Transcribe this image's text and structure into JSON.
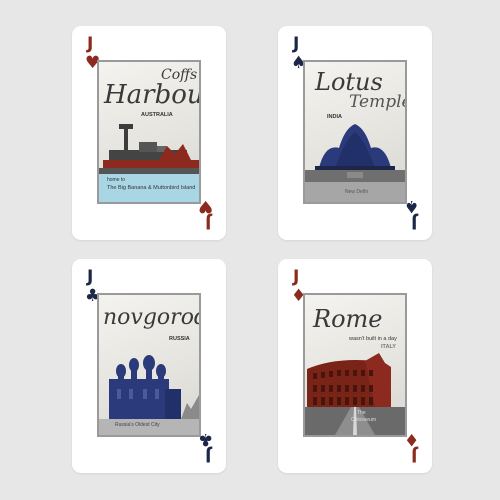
{
  "colors": {
    "background": "#e7e7e7",
    "card": "#ffffff",
    "red_suit": "#8c2a1f",
    "navy_suit": "#1c2748"
  },
  "cards": [
    {
      "rank": "J",
      "suit": "♥",
      "suit_name": "hearts",
      "title_line1": "Coffs",
      "title_line2": "Harbour",
      "country": "AUSTRALIA",
      "caption_line1": "home to",
      "caption_line2": "The Big Banana & Muttonbird Island"
    },
    {
      "rank": "J",
      "suit": "♠",
      "suit_name": "spades",
      "title_line1": "Lotus",
      "title_line2": "Temple",
      "country": "INDIA",
      "caption_line1": "New Delhi"
    },
    {
      "rank": "J",
      "suit": "♣",
      "suit_name": "clubs",
      "title_line1": "novgorod",
      "country": "RUSSIA",
      "caption_line1": "Russia's Oldest City"
    },
    {
      "rank": "J",
      "suit": "♦",
      "suit_name": "diamonds",
      "title_line1": "Rome",
      "subtitle": "wasn't built in a day",
      "country": "ITALY",
      "caption_line1": "The",
      "caption_line2": "Colosseum"
    }
  ]
}
